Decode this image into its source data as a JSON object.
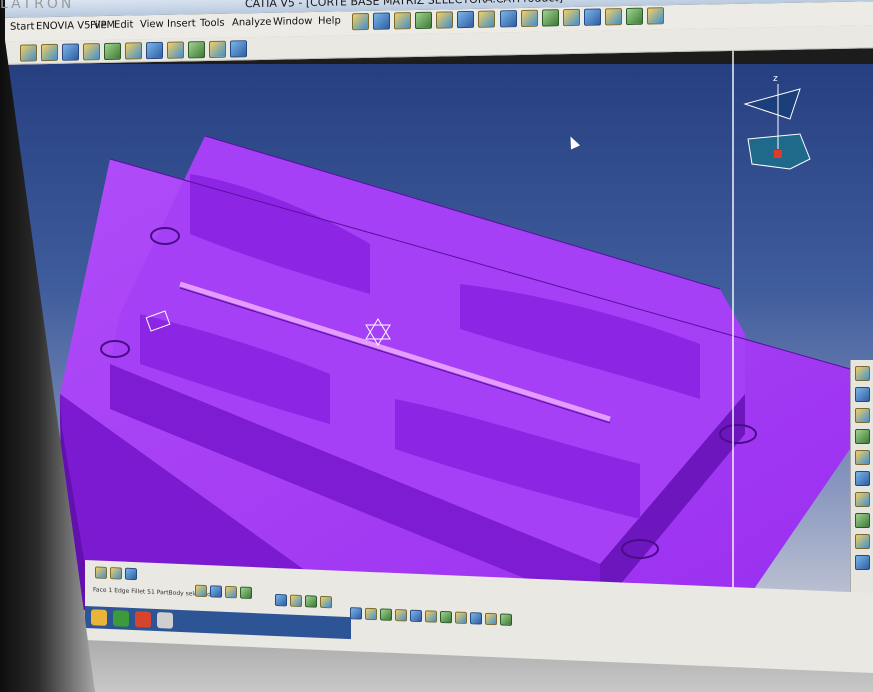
{
  "bezel": {
    "brand": "LATRON"
  },
  "window": {
    "title": "CATIA V5 - [CORTE BASE MATRIZ SELECTORA.CATProduct]"
  },
  "menu": {
    "items": [
      "Start",
      "ENOVIA V5 VPM",
      "File",
      "Edit",
      "View",
      "Insert",
      "Tools",
      "Analyze",
      "Window",
      "Help"
    ]
  },
  "status": {
    "text": "Face 1 Edge Fillet 51 PartBody selected"
  },
  "compass": {
    "axis_label": "z"
  },
  "colors": {
    "part_top": "#a23bf4",
    "part_side": "#8b22e6",
    "part_dark": "#6c14b8",
    "background_top": "#263f80",
    "background_bottom": "#c9cbd6"
  }
}
